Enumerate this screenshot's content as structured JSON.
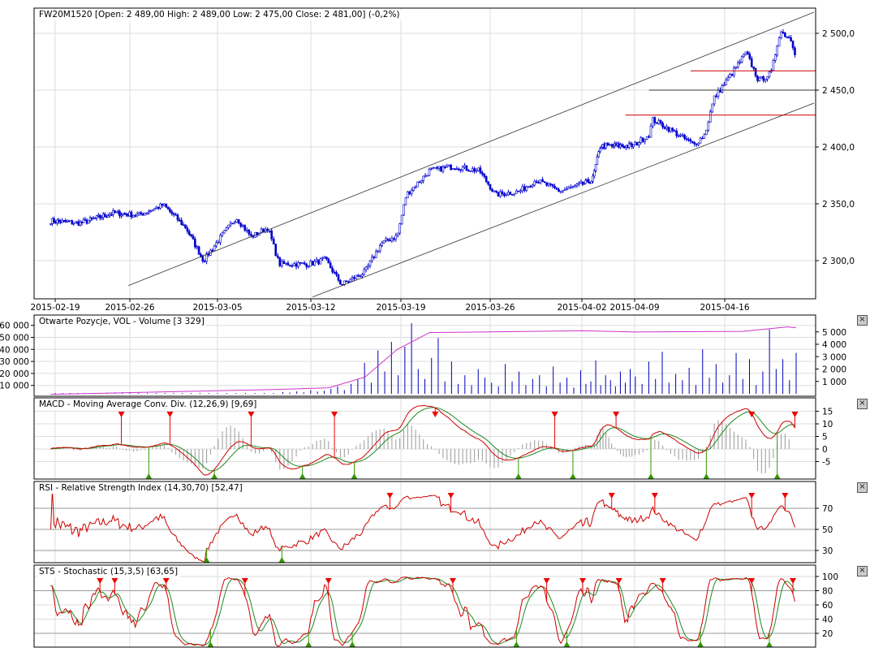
{
  "panels": {
    "main_title": "FW20M1520 [Open: 2 489,00  High: 2 489,00  Low: 2 475,00  Close: 2 481,00] (-0,2%)",
    "volume_title": "Otwarte Pozycje, VOL - Volume [3 329]",
    "macd_title": "MACD - Moving Average Conv. Div. (12,26,9) [9,69]",
    "rsi_title": "RSI - Relative Strength Index (14,30,70) [52,47]",
    "sts_title": "STS - Stochastic (15,3,5) [63,65]",
    "close_icon": "×"
  },
  "colors": {
    "candle": "#0000cc",
    "trend": "#333333",
    "level_red": "#cc0000",
    "oi": "#cc33cc",
    "vol": "#0000bb",
    "macd": "#cc0000",
    "signal": "#228822",
    "hist": "#999999",
    "buy": "#339900",
    "sell": "#ee0000",
    "grid": "#dddddd"
  },
  "chart_data": {
    "type": "line",
    "instrument": "FW20M1520",
    "x_unit": "trading day index from 2015-02-19",
    "date_labels": [
      {
        "label": "2015-02-19",
        "day": 0
      },
      {
        "label": "2015-02-26",
        "day": 5
      },
      {
        "label": "2015-03-05",
        "day": 10
      },
      {
        "label": "2015-03-12",
        "day": 15
      },
      {
        "label": "2015-03-19",
        "day": 20
      },
      {
        "label": "2015-03-26",
        "day": 25
      },
      {
        "label": "2015-04-02",
        "day": 30
      },
      {
        "label": "2015-04-09",
        "day": 34
      },
      {
        "label": "2015-04-16",
        "day": 39
      }
    ],
    "price": {
      "ylim": [
        2266,
        2522
      ],
      "ticks": [
        {
          "v": 2500,
          "label": "2 500,0"
        },
        {
          "v": 2450,
          "label": "2 450,0"
        },
        {
          "v": 2400,
          "label": "2 400,0"
        },
        {
          "v": 2350,
          "label": "2 350,0"
        },
        {
          "v": 2300,
          "label": "2 300,0"
        }
      ],
      "points": [
        [
          -0.3,
          2335
        ],
        [
          1.7,
          2333
        ],
        [
          3.9,
          2342
        ],
        [
          5.5,
          2340
        ],
        [
          6.9,
          2349
        ],
        [
          8.2,
          2329
        ],
        [
          9.2,
          2300
        ],
        [
          10.1,
          2319
        ],
        [
          11.0,
          2338
        ],
        [
          11.8,
          2321
        ],
        [
          12.7,
          2329
        ],
        [
          13.3,
          2297
        ],
        [
          14.9,
          2297
        ],
        [
          15.8,
          2301
        ],
        [
          16.7,
          2279
        ],
        [
          18.0,
          2290
        ],
        [
          18.9,
          2315
        ],
        [
          19.8,
          2322
        ],
        [
          20.3,
          2358
        ],
        [
          21.6,
          2379
        ],
        [
          23.0,
          2383
        ],
        [
          24.4,
          2379
        ],
        [
          25.3,
          2358
        ],
        [
          26.6,
          2361
        ],
        [
          27.5,
          2371
        ],
        [
          28.8,
          2361
        ],
        [
          30.8,
          2371
        ],
        [
          31.4,
          2401
        ],
        [
          33.9,
          2401
        ],
        [
          34.8,
          2411
        ],
        [
          35.0,
          2424
        ],
        [
          35.9,
          2416
        ],
        [
          37.3,
          2402
        ],
        [
          37.9,
          2411
        ],
        [
          38.4,
          2443
        ],
        [
          39.1,
          2458
        ],
        [
          40.2,
          2483
        ],
        [
          40.9,
          2458
        ],
        [
          41.6,
          2465
        ],
        [
          42.1,
          2502
        ],
        [
          42.7,
          2495
        ],
        [
          43.0,
          2481
        ]
      ],
      "trend_lines": [
        {
          "from": [
            4.9,
            2278
          ],
          "to": [
            44,
            2518.6
          ]
        },
        {
          "from": [
            15.1,
            2268
          ],
          "to": [
            44,
            2438.6
          ]
        }
      ],
      "levels": [
        {
          "price": 2467,
          "from_day": 37.1,
          "color": "red"
        },
        {
          "price": 2450,
          "from_day": 34.8,
          "color": "black"
        },
        {
          "price": 2428,
          "from_day": 33.3,
          "color": "red"
        }
      ]
    },
    "volume": {
      "left_ticks": [
        {
          "v": 60000,
          "label": "60 000"
        },
        {
          "v": 50000,
          "label": "50 000"
        },
        {
          "v": 40000,
          "label": "40 000"
        },
        {
          "v": 30000,
          "label": "30 000"
        },
        {
          "v": 20000,
          "label": "20 000"
        },
        {
          "v": 10000,
          "label": "10 000"
        }
      ],
      "right_ticks": [
        {
          "v": 5000,
          "label": "5 000"
        },
        {
          "v": 4000,
          "label": "4 000"
        },
        {
          "v": 3000,
          "label": "3 000"
        },
        {
          "v": 2000,
          "label": "2 000"
        },
        {
          "v": 1000,
          "label": "1 000"
        }
      ],
      "bars_from_day": 13.5,
      "bars_to_day": 43,
      "bars": [
        150,
        100,
        200,
        120,
        300,
        180,
        250,
        400,
        600,
        300,
        800,
        1200,
        2500,
        900,
        3500,
        1800,
        4200,
        1500,
        3800,
        5700,
        2000,
        1200,
        2900,
        4500,
        1000,
        2600,
        800,
        1500,
        700,
        2000,
        1300,
        900,
        600,
        2400,
        1000,
        1800,
        700,
        1200,
        1500,
        600,
        2200,
        900,
        1300,
        500,
        1900,
        800,
        1000,
        2700,
        700,
        1500,
        1100,
        600,
        1800,
        900,
        2000,
        1400,
        800,
        2600,
        1200,
        3400,
        900,
        1600,
        1100,
        2100,
        700,
        3600,
        1300,
        2400,
        900,
        1500,
        3300,
        1200,
        2800,
        700,
        1800,
        5200,
        2000,
        2800,
        1100,
        3300
      ],
      "open_interest": [
        [
          -0.3,
          2600
        ],
        [
          13,
          6600
        ],
        [
          16,
          8000
        ],
        [
          18,
          16900
        ],
        [
          19.8,
          40000
        ],
        [
          21.6,
          54000
        ],
        [
          30,
          55500
        ],
        [
          34,
          54500
        ],
        [
          40,
          55000
        ],
        [
          42.5,
          58700
        ],
        [
          43,
          58000
        ]
      ]
    },
    "macd": {
      "params": "12,26,9",
      "value": 9.69,
      "ticks": [
        15,
        10,
        5,
        0,
        -5
      ]
    },
    "rsi": {
      "params": "14,30,70",
      "value": 52.47,
      "ticks": [
        70,
        50,
        30
      ]
    },
    "sts": {
      "params": "15,3,5",
      "value": 63.65,
      "ticks": [
        100,
        80,
        60,
        40,
        20
      ]
    }
  }
}
